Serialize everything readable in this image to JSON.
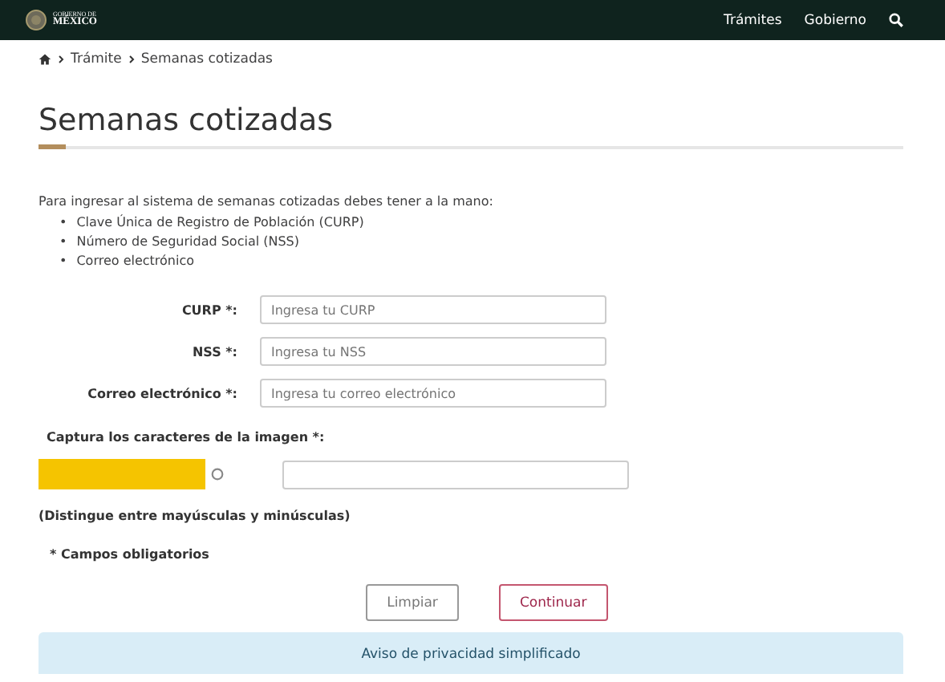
{
  "header": {
    "logo_top": "GOBIERNO DE",
    "logo_bottom": "MÉXICO",
    "nav": [
      "Trámites",
      "Gobierno"
    ]
  },
  "breadcrumb": [
    "Trámite",
    "Semanas cotizadas"
  ],
  "title": "Semanas cotizadas",
  "intro": "Para ingresar al sistema de semanas cotizadas debes tener a la mano:",
  "bullet": "•",
  "requirements": [
    "Clave Única de Registro de Población (CURP)",
    "Número de Seguridad Social (NSS)",
    "Correo electrónico"
  ],
  "fields": [
    {
      "label": "CURP *:",
      "placeholder": "Ingresa tu CURP"
    },
    {
      "label": "NSS *:",
      "placeholder": "Ingresa tu NSS"
    },
    {
      "label": "Correo electrónico *:",
      "placeholder": "Ingresa tu correo electrónico"
    }
  ],
  "captcha": {
    "label": "Captura los caracteres de la imagen *:",
    "note": "(Distingue entre mayúsculas y minúsculas)"
  },
  "required_note": "* Campos obligatorios",
  "buttons": [
    {
      "label": "Limpiar",
      "kind": "secondary"
    },
    {
      "label": "Continuar",
      "kind": "primary"
    }
  ],
  "privacy": "Aviso de privacidad simplificado"
}
